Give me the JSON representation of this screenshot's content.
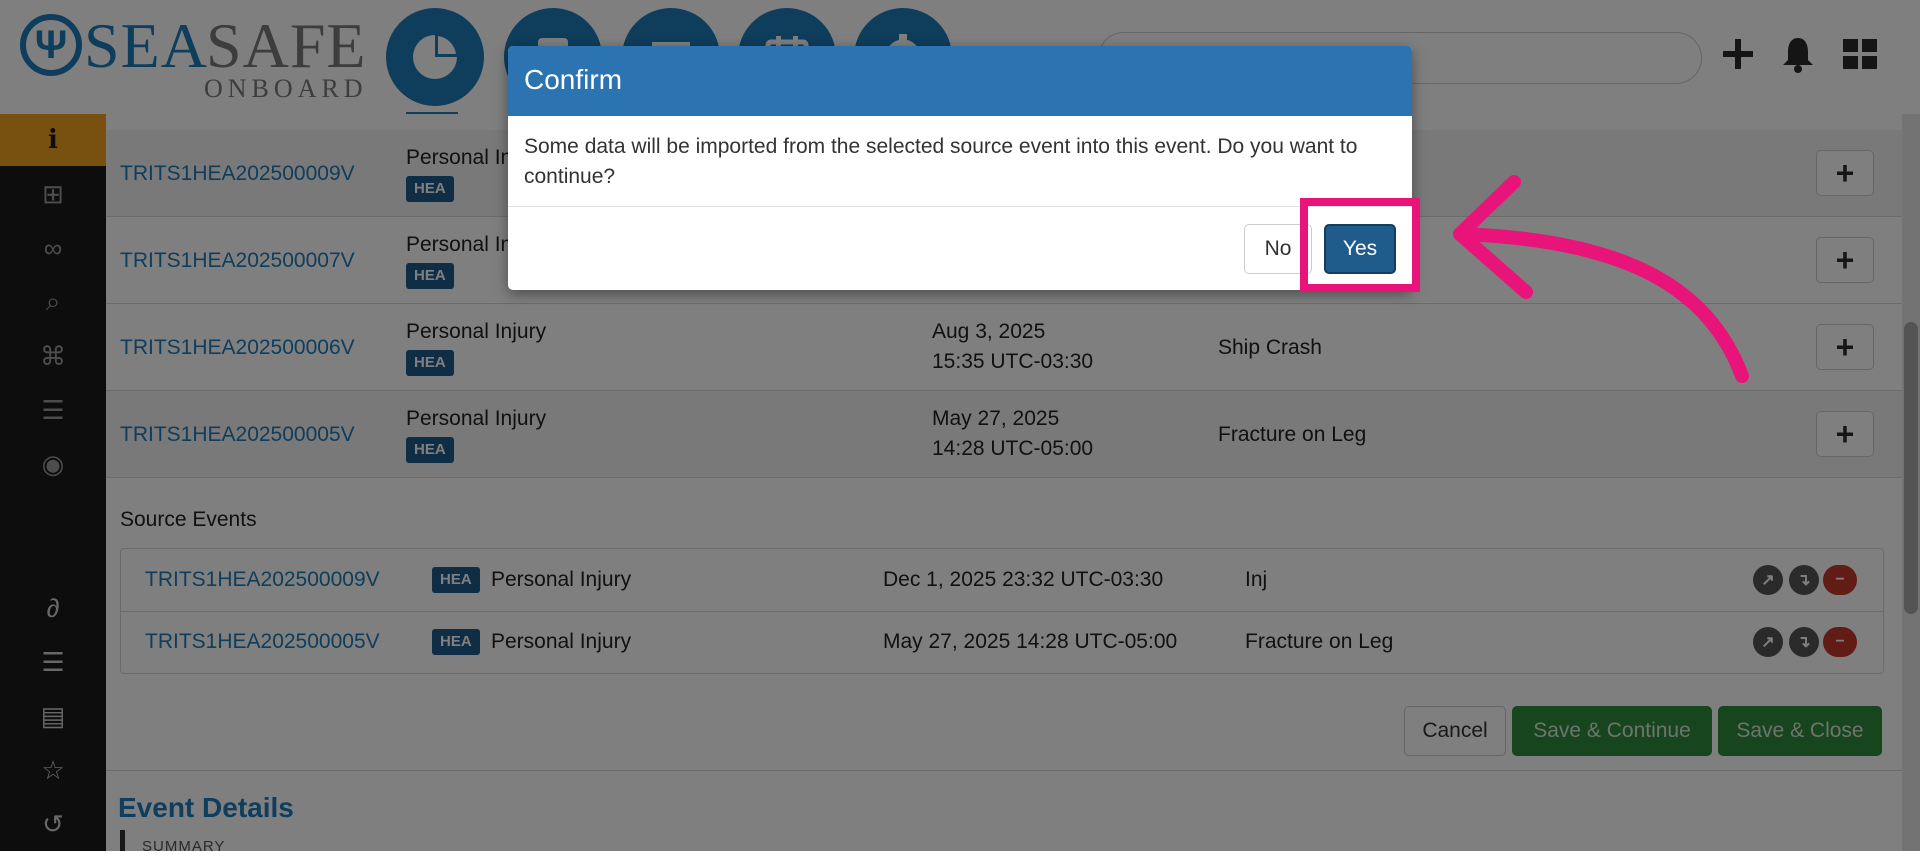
{
  "brand": {
    "logo_sea": "SEA",
    "logo_safe": "SAFE",
    "logo_onboard": "ONBOARD"
  },
  "nav_icons": [
    "pie-chart-icon",
    "clipboard-icon",
    "list-icon",
    "calendar-icon",
    "gear-icon"
  ],
  "header_icons": [
    "plus-icon",
    "bell-icon",
    "grid-icon"
  ],
  "sidebar_icons": [
    "info-icon",
    "org-chart-icon",
    "link-icon",
    "search-icon",
    "tag-icon",
    "server-icon",
    "comments-icon",
    "paperclip-icon",
    "layers-icon",
    "document-icon",
    "star-icon",
    "history-icon"
  ],
  "events": [
    {
      "id": "TRITS1HEA202500009V",
      "type": "Personal Injury",
      "badge": "HEA",
      "date": "",
      "time": "",
      "title": ""
    },
    {
      "id": "TRITS1HEA202500007V",
      "type": "Personal Injury",
      "badge": "HEA",
      "date": "",
      "time": "",
      "title": ""
    },
    {
      "id": "TRITS1HEA202500006V",
      "type": "Personal Injury",
      "badge": "HEA",
      "date": "Aug 3, 2025",
      "time": "15:35 UTC-03:30",
      "title": "Ship Crash"
    },
    {
      "id": "TRITS1HEA202500005V",
      "type": "Personal Injury",
      "badge": "HEA",
      "date": "May 27, 2025",
      "time": "14:28 UTC-05:00",
      "title": "Fracture on Leg"
    }
  ],
  "source_events": {
    "label": "Source Events",
    "rows": [
      {
        "id": "TRITS1HEA202500009V",
        "badge": "HEA",
        "type": "Personal Injury",
        "datetime": "Dec 1, 2025 23:32 UTC-03:30",
        "title": "Inj"
      },
      {
        "id": "TRITS1HEA202500005V",
        "badge": "HEA",
        "type": "Personal Injury",
        "datetime": "May 27, 2025 14:28 UTC-05:00",
        "title": "Fracture on Leg"
      }
    ]
  },
  "actions": {
    "cancel": "Cancel",
    "save_continue": "Save & Continue",
    "save_close": "Save & Close"
  },
  "event_details": {
    "heading": "Event Details",
    "summary": "SUMMARY"
  },
  "modal": {
    "title": "Confirm",
    "message": "Some data will be imported from the selected source event into this event. Do you want to continue?",
    "no": "No",
    "yes": "Yes"
  },
  "colors": {
    "accent": "#1f7ab8",
    "badge": "#1f5c8c",
    "sidebar_active": "#f0a020",
    "green": "#2e8b3a",
    "highlight": "#e8147a"
  }
}
